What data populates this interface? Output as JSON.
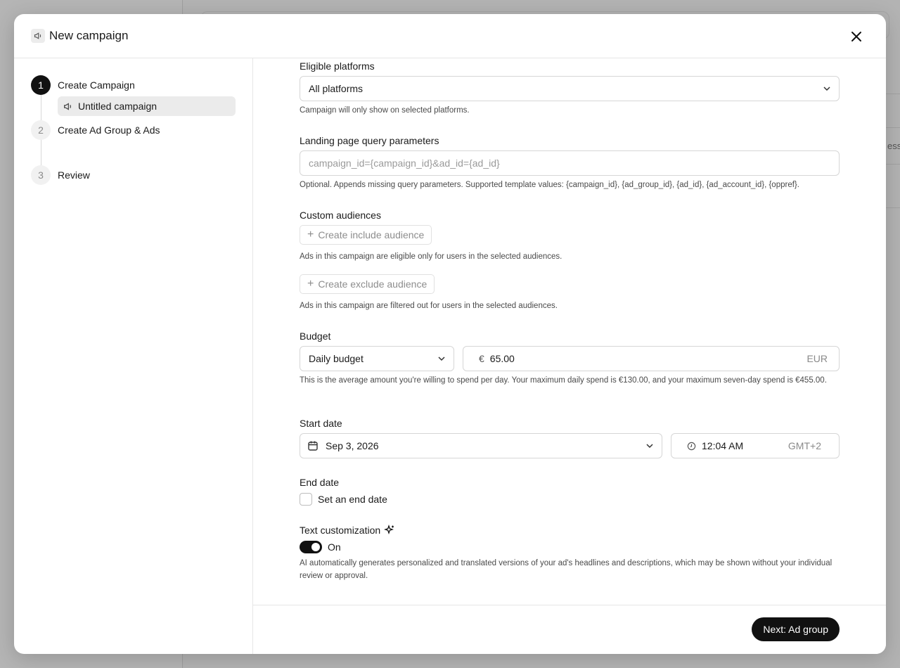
{
  "modal": {
    "title": "New campaign"
  },
  "steps": [
    {
      "num": "1",
      "label": "Create Campaign"
    },
    {
      "num": "2",
      "label": "Create Ad Group & Ads"
    },
    {
      "num": "3",
      "label": "Review"
    }
  ],
  "sub_item": {
    "label": "Untitled campaign"
  },
  "platforms": {
    "label": "Eligible platforms",
    "value": "All platforms",
    "help": "Campaign will only show on selected platforms."
  },
  "query_params": {
    "label": "Landing page query parameters",
    "placeholder": "campaign_id={campaign_id}&ad_id={ad_id}",
    "help": "Optional. Appends missing query parameters. Supported template values: {campaign_id}, {ad_group_id}, {ad_id}, {ad_account_id}, {oppref}."
  },
  "audiences": {
    "label": "Custom audiences",
    "include_button": "Create include audience",
    "include_help": "Ads in this campaign are eligible only for users in the selected audiences.",
    "exclude_button": "Create exclude audience",
    "exclude_help": "Ads in this campaign are filtered out for users in the selected audiences."
  },
  "budget": {
    "label": "Budget",
    "type": "Daily budget",
    "currency_symbol": "€",
    "amount": "65.00",
    "currency": "EUR",
    "help": "This is the average amount you're willing to spend per day. Your maximum daily spend is €130.00, and your maximum seven-day spend is €455.00."
  },
  "start_date": {
    "label": "Start date",
    "date": "Sep 3, 2026",
    "time": "12:04 AM",
    "timezone": "GMT+2"
  },
  "end_date": {
    "label": "End date",
    "checkbox_label": "Set an end date"
  },
  "text_customization": {
    "label": "Text customization",
    "toggle_state": "On",
    "help": "AI automatically generates personalized and translated versions of your ad's headlines and descriptions, which may be shown without your individual review or approval."
  },
  "footer": {
    "next_label": "Next: Ad group"
  },
  "background": {
    "peek_text": "essi"
  }
}
